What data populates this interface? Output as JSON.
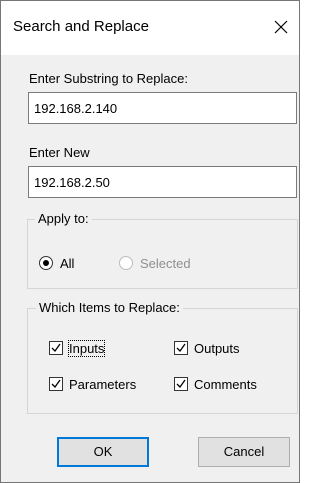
{
  "dialog": {
    "title": "Search and Replace",
    "close_icon": "close-icon"
  },
  "find": {
    "label": "Enter Substring to Replace:",
    "value": "192.168.2.140"
  },
  "replace": {
    "label": "Enter New",
    "value": "192.168.2.50"
  },
  "apply_to": {
    "legend": "Apply to:",
    "options": [
      {
        "label": "All",
        "selected": true,
        "enabled": true
      },
      {
        "label": "Selected",
        "selected": false,
        "enabled": false
      }
    ]
  },
  "items": {
    "legend": "Which Items to Replace:",
    "checkboxes": [
      {
        "label": "Inputs",
        "checked": true
      },
      {
        "label": "Outputs",
        "checked": true
      },
      {
        "label": "Parameters",
        "checked": true
      },
      {
        "label": "Comments",
        "checked": true
      }
    ]
  },
  "buttons": {
    "ok": "OK",
    "cancel": "Cancel"
  },
  "colors": {
    "accent": "#0078d7",
    "dialog_bg": "#f0f0f0",
    "titlebar_bg": "#ffffff"
  }
}
